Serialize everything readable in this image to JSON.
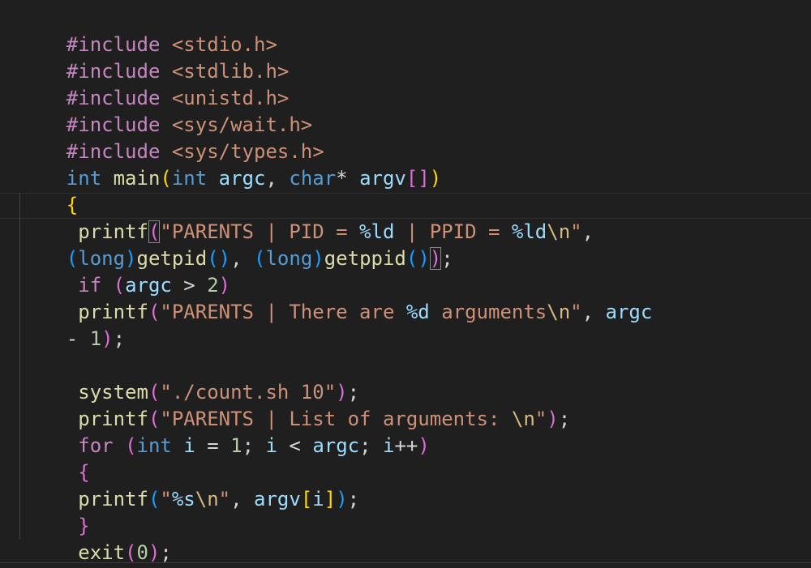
{
  "editor": {
    "language": "c",
    "theme": "dark",
    "code": {
      "includes": [
        {
          "directive": "#include",
          "header": "<stdio.h>"
        },
        {
          "directive": "#include",
          "header": "<stdlib.h>"
        },
        {
          "directive": "#include",
          "header": "<unistd.h>"
        },
        {
          "directive": "#include",
          "header": "<sys/wait.h>"
        },
        {
          "directive": "#include",
          "header": "<sys/types.h>"
        }
      ],
      "main_sig": {
        "ret_type": "int",
        "name": "main",
        "p1_type": "int",
        "p1_name": "argc",
        "p2_type": "char",
        "p2_name": "argv"
      },
      "printf1": {
        "fn": "printf",
        "str_a": "\"PARENTS | PID = ",
        "fmt_a": "%ld",
        "str_b": " | PPID = ",
        "fmt_b": "%ld",
        "esc": "\\n",
        "str_end": "\"",
        "cast1": "long",
        "call1": "getpid",
        "cast2": "long",
        "call2": "getppid"
      },
      "if_stmt": {
        "kw": "if",
        "var": "argc",
        "op": " > ",
        "num": "2"
      },
      "printf2": {
        "fn": "printf",
        "str_a": "\"PARENTS | There are ",
        "fmt": "%d",
        "str_b": " arguments",
        "esc": "\\n",
        "str_end": "\"",
        "var": "argc",
        "minus": "- ",
        "num": "1"
      },
      "system_call": {
        "fn": "system",
        "str": "\"./count.sh 10\""
      },
      "printf3": {
        "fn": "printf",
        "str_a": "\"PARENTS | List of arguments: ",
        "esc": "\\n",
        "str_end": "\""
      },
      "for_stmt": {
        "kw": "for",
        "type": "int",
        "var_i": "i",
        "init": "1",
        "cond_var": "i",
        "limit": "argc",
        "inc_var": "i",
        "inc_op": "++"
      },
      "printf4": {
        "fn": "printf",
        "str_a": "\"",
        "fmt": "%s",
        "esc": "\\n",
        "str_end": "\"",
        "arr": "argv",
        "idx": "i"
      },
      "exit_call": {
        "fn": "exit",
        "num": "0"
      }
    }
  }
}
